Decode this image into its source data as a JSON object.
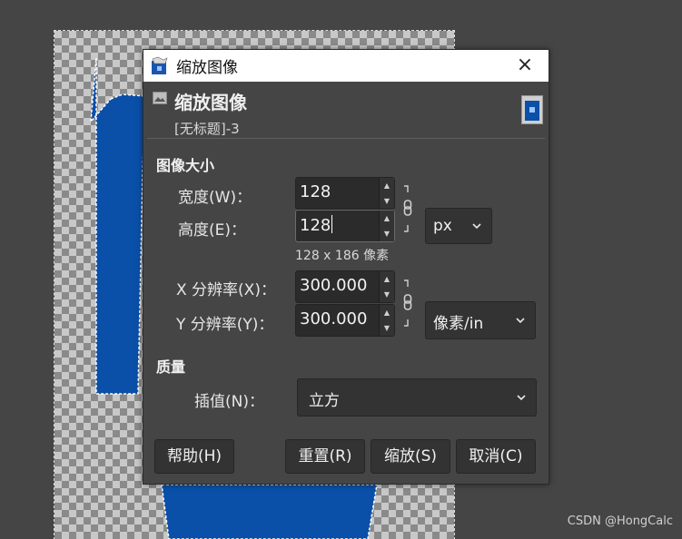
{
  "canvas": {
    "object_color": "#0a4fa8"
  },
  "dialog": {
    "window_title": "缩放图像",
    "close_icon": "×",
    "header_title": "缩放图像",
    "header_subtitle": "[无标题]-3",
    "image_size_section": "图像大小",
    "width_label": "宽度(W)：",
    "width_value": "128",
    "height_label": "高度(E)：",
    "height_value": "128",
    "size_unit": "px",
    "pixel_info": "128 x 186 像素",
    "x_res_label": "X 分辨率(X)：",
    "x_res_value": "300.000",
    "y_res_label": "Y 分辨率(Y)：",
    "y_res_value": "300.000",
    "res_unit": "像素/in",
    "quality_section": "质量",
    "interp_label": "插值(N)：",
    "interp_value": "立方",
    "buttons": {
      "help": "帮助(H)",
      "reset": "重置(R)",
      "scale": "缩放(S)",
      "cancel": "取消(C)"
    }
  },
  "watermark": "CSDN @HongCalc"
}
